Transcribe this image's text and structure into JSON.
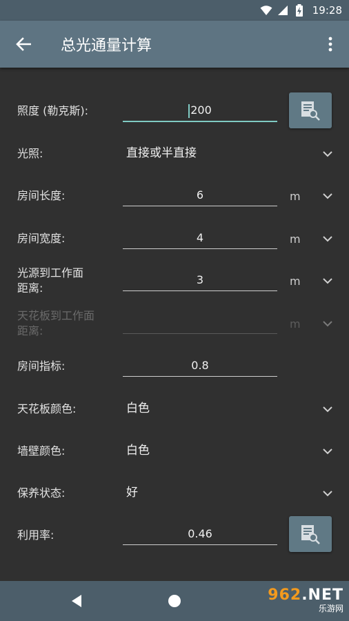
{
  "status_bar": {
    "time": "19:28"
  },
  "app_bar": {
    "title": "总光通量计算"
  },
  "form": {
    "illuminance": {
      "label": "照度 (勒克斯):",
      "value": "200"
    },
    "lighting": {
      "label": "光照:",
      "value": "直接或半直接"
    },
    "room_length": {
      "label": "房间长度:",
      "value": "6",
      "unit": "m"
    },
    "room_width": {
      "label": "房间宽度:",
      "value": "4",
      "unit": "m"
    },
    "source_to_workplane": {
      "label_line1": "光源到工作面",
      "label_line2": "距离:",
      "value": "3",
      "unit": "m"
    },
    "ceiling_to_workplane": {
      "label_line1": "天花板到工作面",
      "label_line2": "距离:",
      "value": "",
      "unit": "m"
    },
    "room_index": {
      "label": "房间指标:",
      "value": "0.8"
    },
    "ceiling_color": {
      "label": "天花板颜色:",
      "value": "白色"
    },
    "wall_color": {
      "label": "墙壁颜色:",
      "value": "白色"
    },
    "maintenance": {
      "label": "保养状态:",
      "value": "好"
    },
    "utilization": {
      "label": "利用率:",
      "value": "0.46"
    }
  },
  "watermark": {
    "line1_a": "9",
    "line1_b": "6",
    "line1_c": "2",
    "line1_d": ".NET",
    "line2": "乐游网"
  },
  "colors": {
    "app_bar": "#5e7482",
    "status_bar": "#4c5e6a",
    "background": "#303030",
    "accent": "#80cbc4"
  }
}
